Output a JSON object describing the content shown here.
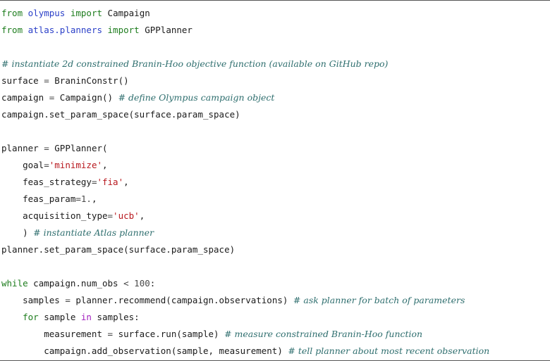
{
  "code": {
    "l1": {
      "a": "from",
      "b": " ",
      "c": "olympus",
      "d": " ",
      "e": "import",
      "f": " Campaign"
    },
    "l2": {
      "a": "from",
      "b": " ",
      "c": "atlas.planners",
      "d": " ",
      "e": "import",
      "f": " GPPlanner"
    },
    "l3": {
      "c": "# instantiate 2d constrained Branin-Hoo objective function (available on GitHub repo)"
    },
    "l4": {
      "a": "surface ",
      "b": "=",
      "c": " BraninConstr()"
    },
    "l5": {
      "a": "campaign ",
      "b": "=",
      "c": " Campaign() ",
      "d": "# define Olympus campaign object"
    },
    "l6": {
      "a": "campaign.set_param_space(surface.param_space)"
    },
    "l7": {
      "a": "planner ",
      "b": "=",
      "c": " GPPlanner("
    },
    "l8": {
      "a": "    goal",
      "b": "=",
      "c": "'minimize'",
      "d": ","
    },
    "l9": {
      "a": "    feas_strategy",
      "b": "=",
      "c": "'fia'",
      "d": ","
    },
    "l10": {
      "a": "    feas_param",
      "b": "=",
      "c": "1.",
      "d": ","
    },
    "l11": {
      "a": "    acquisition_type",
      "b": "=",
      "c": "'ucb'",
      "d": ","
    },
    "l12": {
      "a": "    ) ",
      "b": "# instantiate Atlas planner"
    },
    "l13": {
      "a": "planner.set_param_space(surface.param_space)"
    },
    "l14": {
      "a": "while",
      "b": " campaign.num_obs ",
      "c": "<",
      "d": " ",
      "e": "100",
      "f": ":"
    },
    "l15": {
      "a": "    samples ",
      "b": "=",
      "c": " planner.recommend(campaign.observations) ",
      "d": "# ask planner for batch of parameters"
    },
    "l16": {
      "a": "    ",
      "b": "for",
      "c": " sample ",
      "d": "in",
      "e": " samples:"
    },
    "l17": {
      "a": "        measurement ",
      "b": "=",
      "c": " surface.run(sample) ",
      "d": "# measure constrained Branin-Hoo function"
    },
    "l18": {
      "a": "        campaign.add_observation(sample, measurement) ",
      "b": "# tell planner about most recent observation"
    }
  }
}
